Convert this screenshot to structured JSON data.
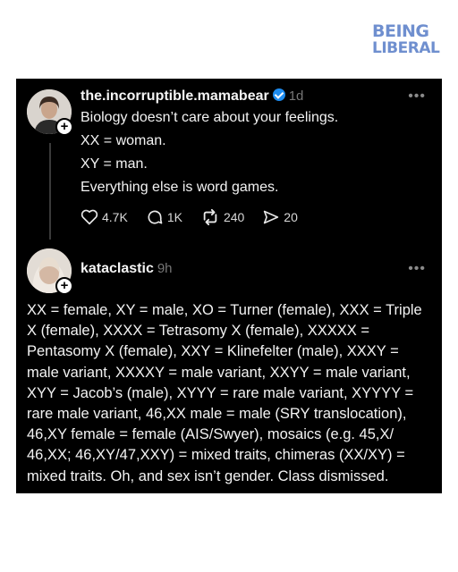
{
  "watermark": {
    "line1": "BEING",
    "line2": "LIBERAL"
  },
  "post": {
    "username": "the.incorruptible.mamabear",
    "time": "1d",
    "more": "•••",
    "lines": [
      "Biology doesn’t care about your feelings.",
      "XX = woman.",
      "XY = man.",
      "Everything else is word games."
    ],
    "likes": "4.7K",
    "comments": "1K",
    "reposts": "240",
    "shares": "20"
  },
  "reply": {
    "username": "kataclastic",
    "time": "9h",
    "more": "•••",
    "lines": [
      "XX = female, XY = male, XO = Turner (female), XXX = Triple",
      "X (female), XXXX = Tetrasomy X (female), XXXXX =",
      "Pentasomy X (female), XXY = Klinefelter (male), XXXY =",
      "male variant, XXXXY = male variant, XXYY = male variant,",
      "XYY = Jacob’s (male), XYYY = rare male variant, XYYYY =",
      "rare male variant, 46,XX male = male (SRY translocation),",
      "46,XY female = female (AIS/Swyer), mosaics (e.g. 45,X/",
      "46,XX; 46,XY/47,XXY) = mixed traits, chimeras (XX/XY) =",
      "mixed traits. Oh, and sex isn’t gender. Class dismissed."
    ]
  },
  "plus_symbol": "+"
}
